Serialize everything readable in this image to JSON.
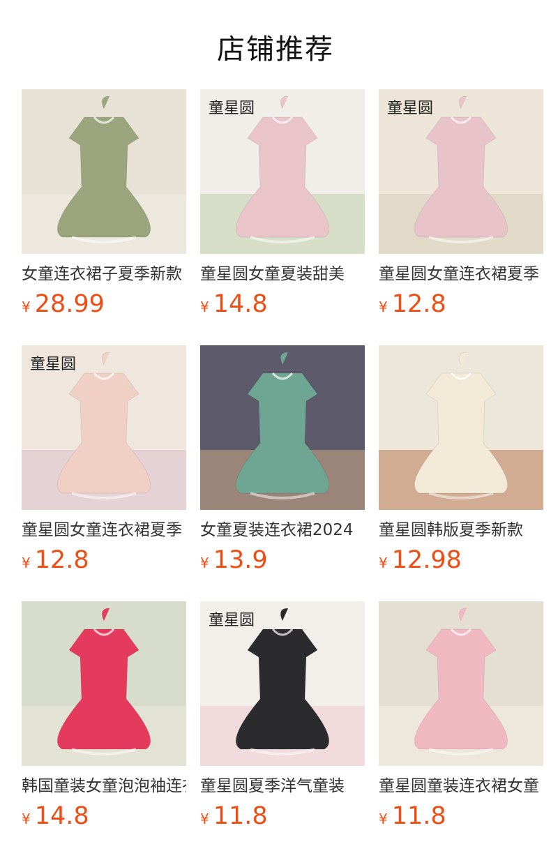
{
  "page_title": "店铺推荐",
  "currency_symbol": "¥",
  "products": [
    {
      "name": "女童连衣裙子夏季新款",
      "price": "28.99",
      "colors": {
        "bg": "#e7e1d6",
        "main": "#9aa57e",
        "accent": "#f4f1e8"
      }
    },
    {
      "name": "童星圆女童夏装甜美",
      "price": "14.8",
      "watermark": "童星圆",
      "colors": {
        "bg": "#f1eeea",
        "main": "#e9c4c8",
        "accent": "#b9c9a0"
      }
    },
    {
      "name": "童星圆女童连衣裙夏季",
      "price": "12.8",
      "watermark": "童星圆",
      "colors": {
        "bg": "#ece5d8",
        "main": "#e8c3c9",
        "accent": "#d8cdb8"
      }
    },
    {
      "name": "童星圆女童连衣裙夏季",
      "price": "12.8",
      "watermark": "童星圆",
      "colors": {
        "bg": "#efe7de",
        "main": "#f0cfc4",
        "accent": "#d9b9c8"
      }
    },
    {
      "name": "女童夏装连衣裙2024",
      "price": "13.9",
      "colors": {
        "bg": "#5d5a6b",
        "main": "#6fa593",
        "accent": "#e6b98a"
      }
    },
    {
      "name": "童星圆韩版夏季新款",
      "price": "12.98",
      "colors": {
        "bg": "#ede6da",
        "main": "#f2ead6",
        "accent": "#b0673a"
      }
    },
    {
      "name": "韩国童装女童泡泡袖连衣裙",
      "price": "14.8",
      "colors": {
        "bg": "#d7dccb",
        "main": "#e33a5d",
        "accent": "#f1ebe2"
      }
    },
    {
      "name": "童星圆夏季洋气童装",
      "price": "11.8",
      "watermark": "童星圆",
      "colors": {
        "bg": "#f2eeea",
        "main": "#2b2b2e",
        "accent": "#efc3cc"
      }
    },
    {
      "name": "童星圆童装连衣裙女童",
      "price": "11.8",
      "colors": {
        "bg": "#e5dfd3",
        "main": "#f0b9c2",
        "accent": "#f6f2e6"
      }
    }
  ]
}
